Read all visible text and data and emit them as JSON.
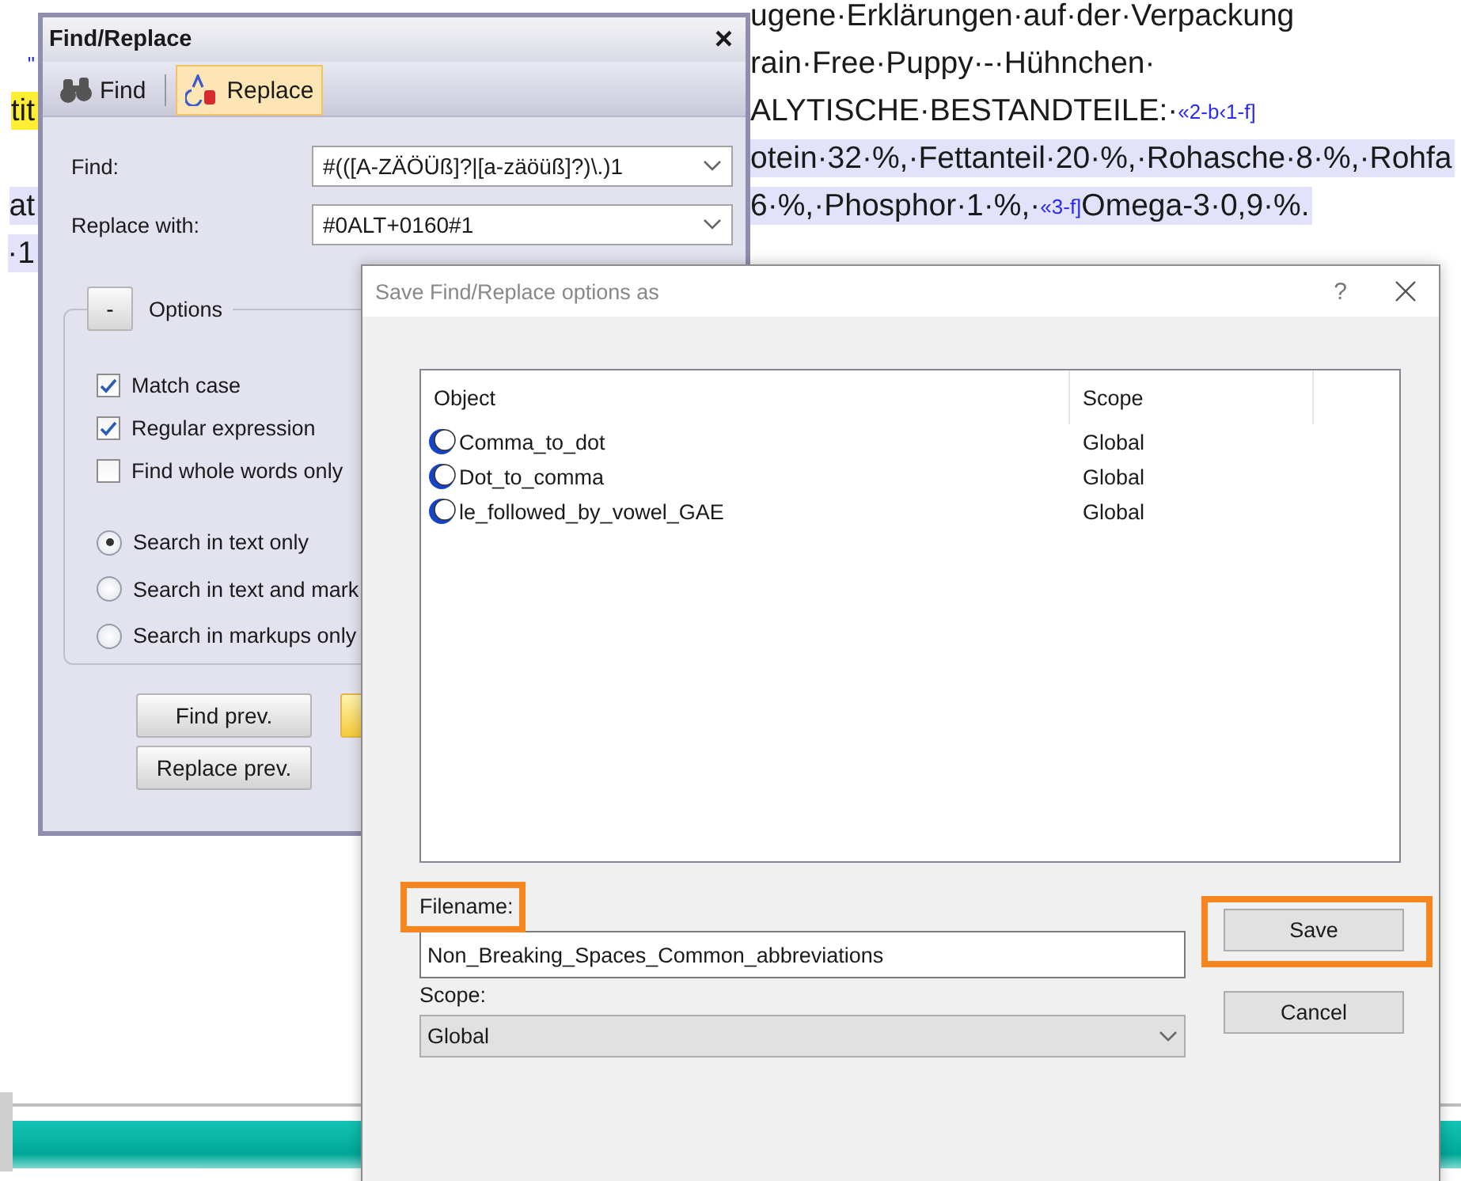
{
  "document": {
    "rows": [
      {
        "right": {
          "segments": [
            {
              "kind": "text",
              "text": "ugene·Erklärungen·auf·der·Verpackung"
            }
          ],
          "selected": false
        }
      },
      {
        "left": {
          "segments": [
            {
              "kind": "tag",
              "text": "\""
            }
          ],
          "selected": false,
          "marked": false
        },
        "right": {
          "segments": [
            {
              "kind": "text",
              "text": "rain·Free·Puppy·-·Hühnchen·"
            }
          ],
          "selected": false
        }
      },
      {
        "left": {
          "segments": [
            {
              "kind": "text",
              "text": "tit"
            }
          ],
          "selected": false,
          "marked": true
        },
        "right": {
          "segments": [
            {
              "kind": "text",
              "text": "ALYTISCHE·BESTANDTEILE:·"
            },
            {
              "kind": "tag",
              "text": "«2-b‹1-f]"
            }
          ],
          "selected": false
        }
      },
      {
        "right": {
          "segments": [
            {
              "kind": "text",
              "text": "otein·32·%,·Fettanteil·20·%,·Rohasche·8·%,·Rohfa"
            }
          ],
          "selected": true
        }
      },
      {
        "left": {
          "segments": [
            {
              "kind": "text",
              "text": "at"
            }
          ],
          "selected": true,
          "marked": false
        },
        "right": {
          "segments": [
            {
              "kind": "text",
              "text": "6·%,·Phosphor·1·%,·"
            },
            {
              "kind": "tag",
              "text": "«3-f]"
            },
            {
              "kind": "text",
              "text": "Omega-3·0,9·%."
            }
          ],
          "selected": true
        }
      },
      {
        "left": {
          "segments": [
            {
              "kind": "text",
              "text": "·1"
            }
          ],
          "selected": true,
          "marked": false
        }
      }
    ]
  },
  "find_replace": {
    "title": "Find/Replace",
    "close": "×",
    "tabs": [
      {
        "label": "Find",
        "selected": false
      },
      {
        "label": "Replace",
        "selected": true
      }
    ],
    "fields": [
      {
        "label": "Find:",
        "value": "#(([A-ZÄÖÜß]?|[a-zäöüß]?)\\.)1"
      },
      {
        "label": "Replace with:",
        "value": "#0ALT+0160#1"
      }
    ],
    "options": {
      "toggle": "-",
      "title": "Options",
      "checkboxes": [
        {
          "label": "Match case",
          "checked": true
        },
        {
          "label": "Regular expression",
          "checked": true
        },
        {
          "label": "Find whole words only",
          "checked": false
        }
      ],
      "radios": [
        {
          "label": "Search in text only",
          "selected": true
        },
        {
          "label": "Search in text and mark",
          "selected": false
        },
        {
          "label": "Search in markups only",
          "selected": false
        }
      ]
    },
    "buttons": [
      {
        "label": "Find prev.",
        "kind": "plain"
      },
      {
        "kind": "accent"
      },
      {
        "label": "Replace prev.",
        "kind": "plain"
      }
    ]
  },
  "save_dialog": {
    "title": "Save Find/Replace options as",
    "help": "?",
    "list": {
      "columns": [
        "Object",
        "Scope"
      ],
      "rows": [
        {
          "object": "Comma_to_dot",
          "scope": "Global"
        },
        {
          "object": "Dot_to_comma",
          "scope": "Global"
        },
        {
          "object": "le_followed_by_vowel_GAE",
          "scope": "Global"
        }
      ]
    },
    "filename": {
      "label": "Filename:",
      "value": "Non_Breaking_Spaces_Common_abbreviations",
      "highlighted": true
    },
    "scope": {
      "label": "Scope:",
      "value": "Global"
    },
    "buttons": [
      {
        "label": "Save",
        "highlighted": true
      },
      {
        "label": "Cancel",
        "highlighted": false
      }
    ]
  }
}
